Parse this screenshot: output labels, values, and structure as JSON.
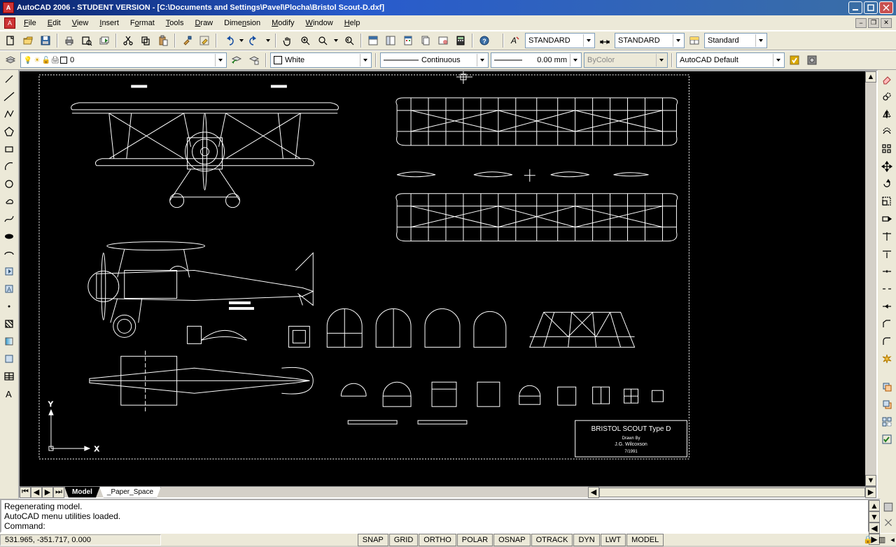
{
  "title": "AutoCAD 2006 - STUDENT VERSION - [C:\\Documents and Settings\\Pavel\\Plocha\\Bristol Scout-D.dxf]",
  "app_icon_letter": "A",
  "menu": {
    "file": "File",
    "edit": "Edit",
    "view": "View",
    "insert": "Insert",
    "format": "Format",
    "tools": "Tools",
    "draw": "Draw",
    "dimension": "Dimension",
    "modify": "Modify",
    "window": "Window",
    "help": "Help"
  },
  "doc_ctrl": {
    "min": "−",
    "restore": "❐",
    "close": "✕"
  },
  "toolbar2": {
    "layer_name": "0",
    "color": "White",
    "linetype": "Continuous",
    "lineweight": "0.00 mm",
    "plotstyle": "ByColor",
    "tablestyle": "AutoCAD Default"
  },
  "toolbar1": {
    "textstyle": "STANDARD",
    "dimstyle": "STANDARD",
    "tablestyle": "Standard"
  },
  "cad": {
    "plate_title": "BRISTOL   SCOUT  Type  D",
    "plate_sub": "Drawn By",
    "plate_credit": "J.G. Wilcoxson",
    "plate_date": "7/1991",
    "tabs": {
      "model": "Model",
      "paper": "_Paper_Space"
    },
    "ucs_x": "X",
    "ucs_y": "Y"
  },
  "command": {
    "lines": "Regenerating model.\nAutoCAD menu utilities loaded.",
    "prompt": "Command:"
  },
  "status": {
    "coord": "531.965, -351.717, 0.000",
    "toggles": [
      "SNAP",
      "GRID",
      "ORTHO",
      "POLAR",
      "OSNAP",
      "OTRACK",
      "DYN",
      "LWT",
      "MODEL"
    ]
  }
}
